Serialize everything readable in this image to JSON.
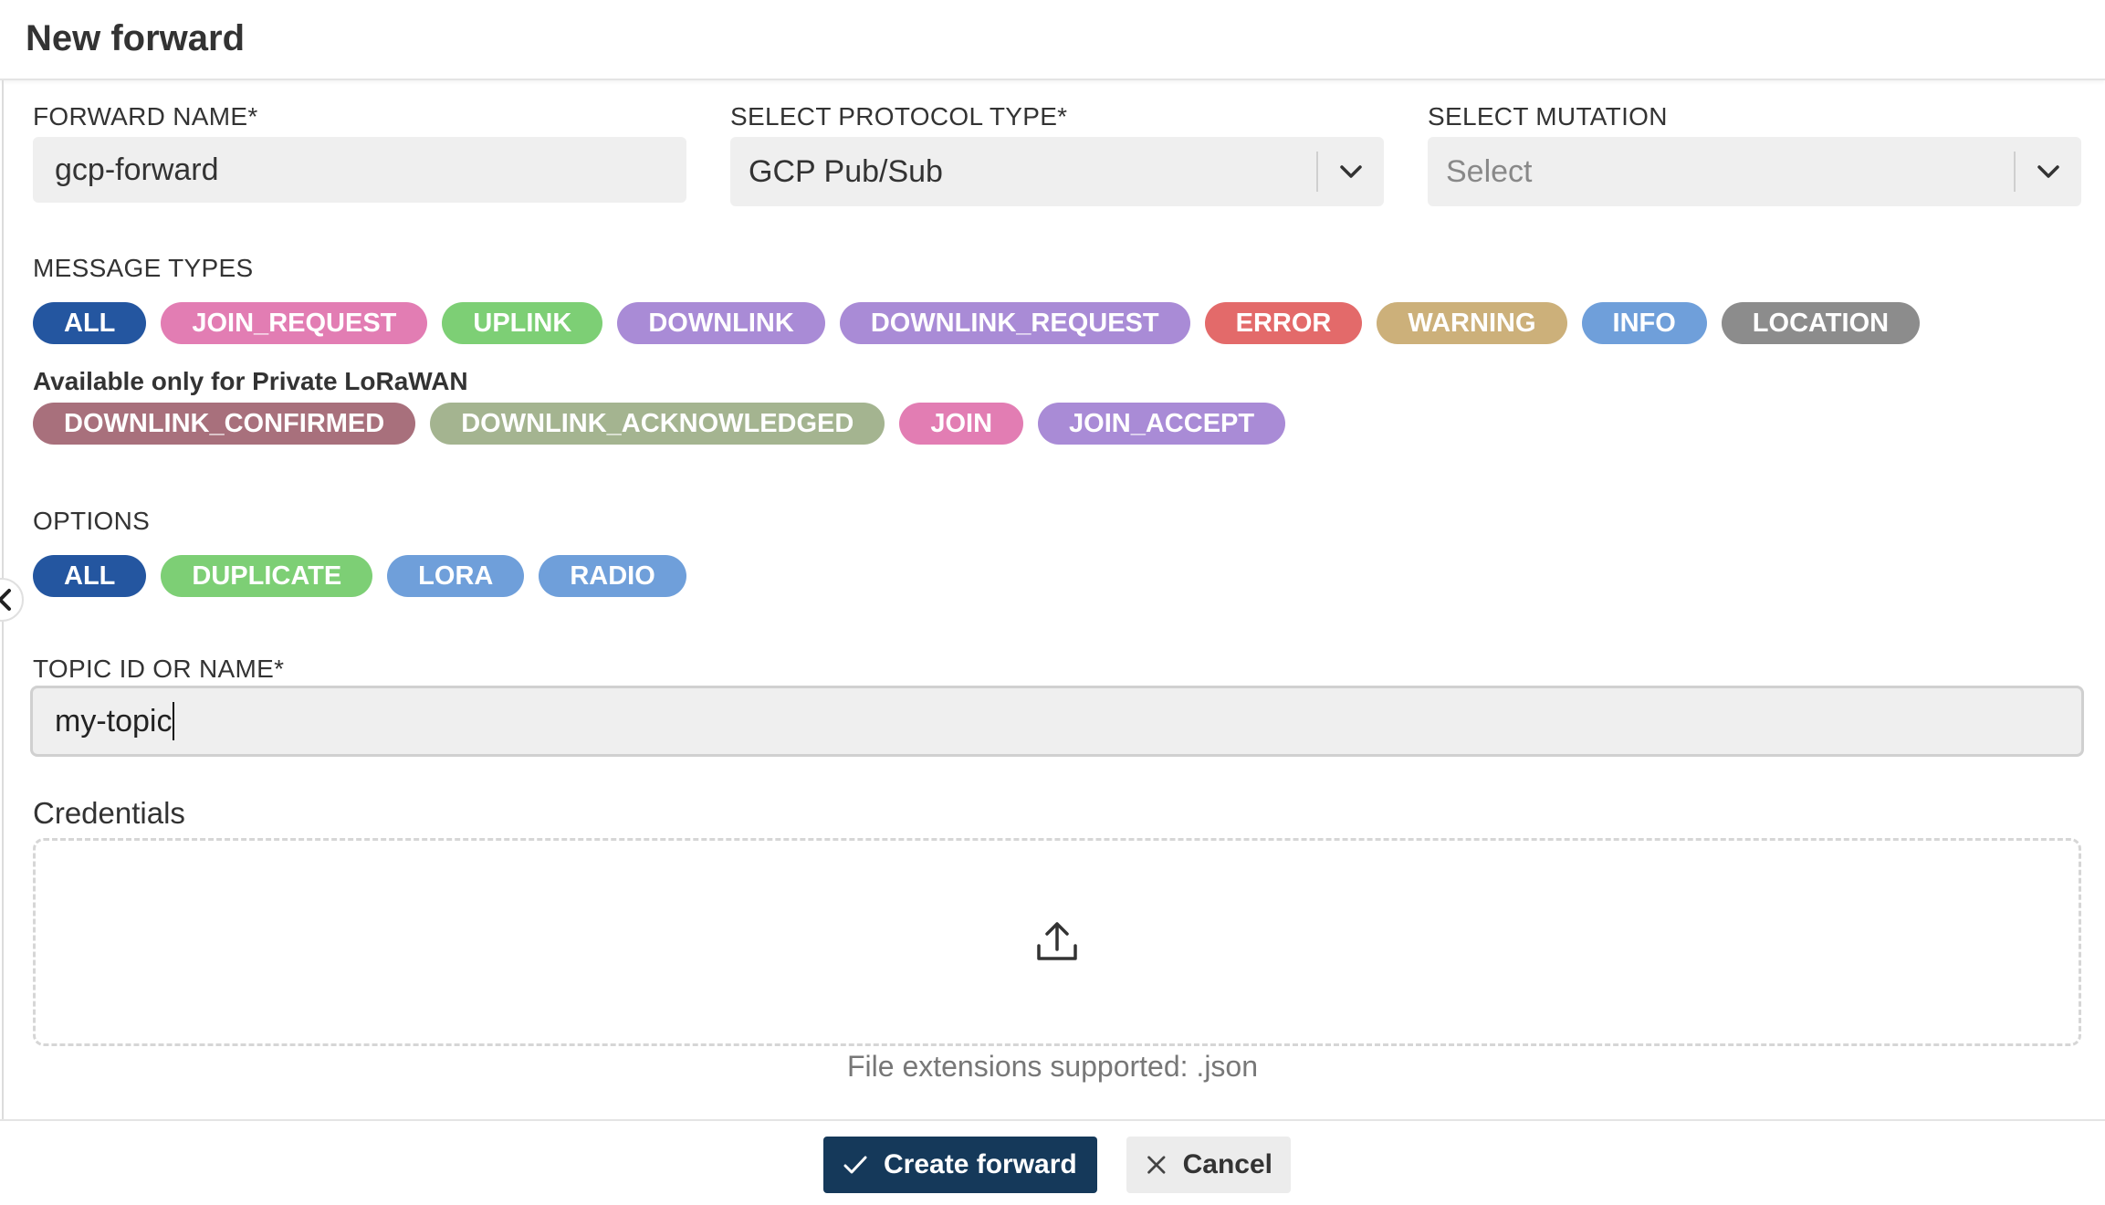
{
  "title": "New forward",
  "forward_name": {
    "label": "FORWARD NAME*",
    "value": "gcp-forward"
  },
  "protocol": {
    "label": "SELECT PROTOCOL TYPE*",
    "value": "GCP Pub/Sub"
  },
  "mutation": {
    "label": "SELECT MUTATION",
    "placeholder": "Select"
  },
  "message_types": {
    "label": "MESSAGE TYPES",
    "items": [
      {
        "label": "ALL",
        "color": "#2456a0"
      },
      {
        "label": "JOIN_REQUEST",
        "color": "#e27db3"
      },
      {
        "label": "UPLINK",
        "color": "#7dcf75"
      },
      {
        "label": "DOWNLINK",
        "color": "#a98bd6"
      },
      {
        "label": "DOWNLINK_REQUEST",
        "color": "#a98bd6"
      },
      {
        "label": "ERROR",
        "color": "#e36a6a"
      },
      {
        "label": "WARNING",
        "color": "#ccb07a"
      },
      {
        "label": "INFO",
        "color": "#6f9fda"
      },
      {
        "label": "LOCATION",
        "color": "#8c8c8c"
      }
    ],
    "private_label": "Available only for Private LoRaWAN",
    "private_items": [
      {
        "label": "DOWNLINK_CONFIRMED",
        "color": "#a8707c"
      },
      {
        "label": "DOWNLINK_ACKNOWLEDGED",
        "color": "#a4b490"
      },
      {
        "label": "JOIN",
        "color": "#e27db3"
      },
      {
        "label": "JOIN_ACCEPT",
        "color": "#a98bd6"
      }
    ]
  },
  "options": {
    "label": "OPTIONS",
    "items": [
      {
        "label": "ALL",
        "color": "#2456a0"
      },
      {
        "label": "DUPLICATE",
        "color": "#7dcf75"
      },
      {
        "label": "LORA",
        "color": "#6f9fda"
      },
      {
        "label": "RADIO",
        "color": "#6f9fda"
      }
    ]
  },
  "topic": {
    "label": "TOPIC ID OR NAME*",
    "value": "my-topic"
  },
  "credentials": {
    "label": "Credentials",
    "hint": "File extensions supported: .json"
  },
  "buttons": {
    "create": "Create forward",
    "cancel": "Cancel"
  }
}
